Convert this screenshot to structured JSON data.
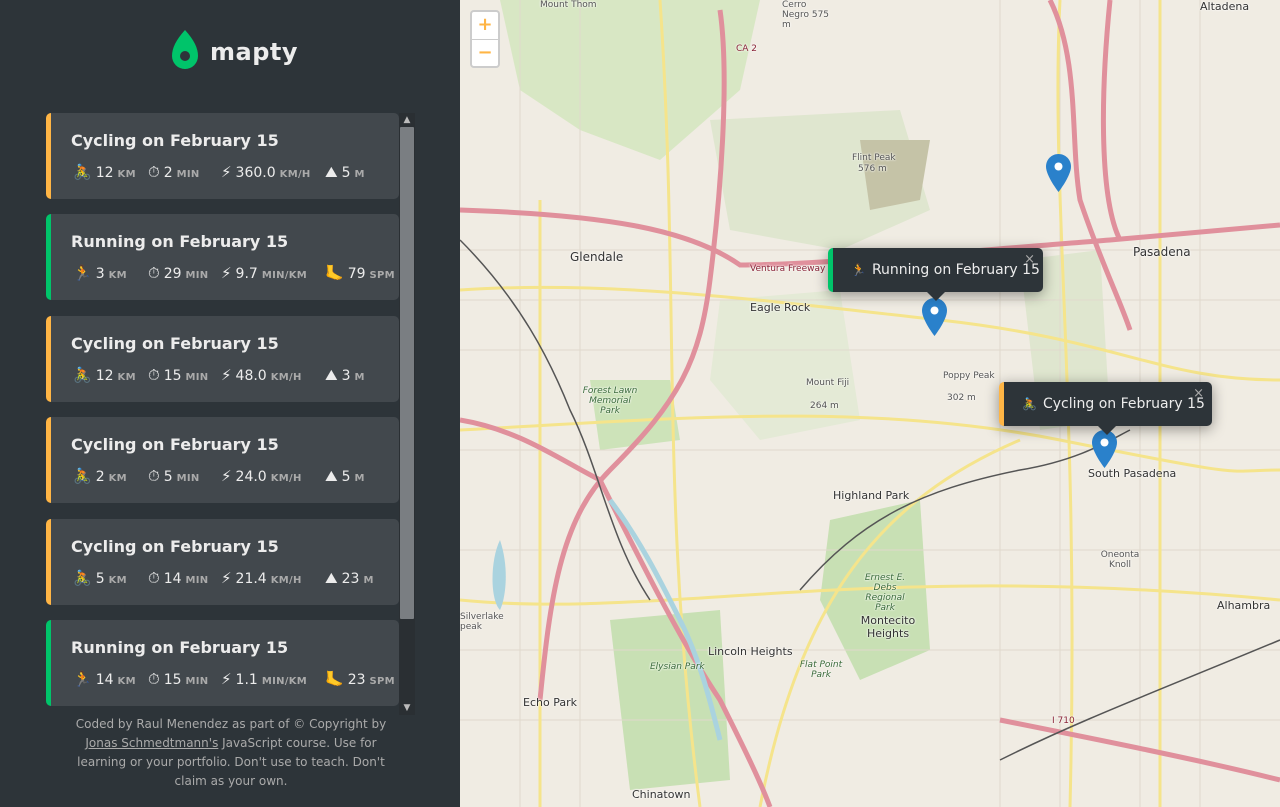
{
  "brand": {
    "name": "mapty"
  },
  "workouts": [
    {
      "type": "cycling",
      "title": "Cycling on February 15",
      "stats": [
        {
          "icon": "bicycle-icon",
          "glyph": "🚴",
          "value": "12",
          "unit": "KM"
        },
        {
          "icon": "stopwatch-icon",
          "glyph": "⏱",
          "value": "2",
          "unit": "MIN"
        },
        {
          "icon": "lightning-icon",
          "glyph": "⚡",
          "value": "360.0",
          "unit": "KM/H"
        },
        {
          "icon": "mountain-icon",
          "glyph": "⛰",
          "value": "5",
          "unit": "M"
        }
      ]
    },
    {
      "type": "running",
      "title": "Running on February 15",
      "stats": [
        {
          "icon": "runner-icon",
          "glyph": "🏃",
          "value": "3",
          "unit": "KM"
        },
        {
          "icon": "stopwatch-icon",
          "glyph": "⏱",
          "value": "29",
          "unit": "MIN"
        },
        {
          "icon": "lightning-icon",
          "glyph": "⚡",
          "value": "9.7",
          "unit": "MIN/KM"
        },
        {
          "icon": "footprint-icon",
          "glyph": "🦶",
          "value": "79",
          "unit": "SPM"
        }
      ]
    },
    {
      "type": "cycling",
      "title": "Cycling on February 15",
      "stats": [
        {
          "icon": "bicycle-icon",
          "glyph": "🚴",
          "value": "12",
          "unit": "KM"
        },
        {
          "icon": "stopwatch-icon",
          "glyph": "⏱",
          "value": "15",
          "unit": "MIN"
        },
        {
          "icon": "lightning-icon",
          "glyph": "⚡",
          "value": "48.0",
          "unit": "KM/H"
        },
        {
          "icon": "mountain-icon",
          "glyph": "⛰",
          "value": "3",
          "unit": "M"
        }
      ]
    },
    {
      "type": "cycling",
      "title": "Cycling on February 15",
      "stats": [
        {
          "icon": "bicycle-icon",
          "glyph": "🚴",
          "value": "2",
          "unit": "KM"
        },
        {
          "icon": "stopwatch-icon",
          "glyph": "⏱",
          "value": "5",
          "unit": "MIN"
        },
        {
          "icon": "lightning-icon",
          "glyph": "⚡",
          "value": "24.0",
          "unit": "KM/H"
        },
        {
          "icon": "mountain-icon",
          "glyph": "⛰",
          "value": "5",
          "unit": "M"
        }
      ]
    },
    {
      "type": "cycling",
      "title": "Cycling on February 15",
      "stats": [
        {
          "icon": "bicycle-icon",
          "glyph": "🚴",
          "value": "5",
          "unit": "KM"
        },
        {
          "icon": "stopwatch-icon",
          "glyph": "⏱",
          "value": "14",
          "unit": "MIN"
        },
        {
          "icon": "lightning-icon",
          "glyph": "⚡",
          "value": "21.4",
          "unit": "KM/H"
        },
        {
          "icon": "mountain-icon",
          "glyph": "⛰",
          "value": "23",
          "unit": "M"
        }
      ]
    },
    {
      "type": "running",
      "title": "Running on February 15",
      "stats": [
        {
          "icon": "runner-icon",
          "glyph": "🏃",
          "value": "14",
          "unit": "KM"
        },
        {
          "icon": "stopwatch-icon",
          "glyph": "⏱",
          "value": "15",
          "unit": "MIN"
        },
        {
          "icon": "lightning-icon",
          "glyph": "⚡",
          "value": "1.1",
          "unit": "MIN/KM"
        },
        {
          "icon": "footprint-icon",
          "glyph": "🦶",
          "value": "23",
          "unit": "SPM"
        }
      ]
    }
  ],
  "footer": {
    "text_before": "Coded by Raul Menendez as part of © Copyright by ",
    "link": "Jonas Schmedtmann's",
    "text_after": " JavaScript course. Use for learning or your portfolio. Don't use to teach. Don't claim as your own."
  },
  "map": {
    "zoom_in": "+",
    "zoom_out": "−",
    "popups": [
      {
        "type": "running",
        "glyph": "🏃",
        "label": "Running on February 15",
        "close": "×"
      },
      {
        "type": "cycling",
        "glyph": "🚴",
        "label": "Cycling on February 15",
        "close": "×"
      }
    ],
    "places": [
      "Glendale",
      "Pasadena",
      "Eagle Rock",
      "Highland Park",
      "South Pasadena",
      "Lincoln Heights",
      "Echo Park",
      "Chinatown",
      "Alhambra",
      "Montecito Heights",
      "Altadena",
      "Flint Peak",
      "576 m",
      "Mount Fiji",
      "264 m",
      "Poppy Peak",
      "302 m",
      "Forest Lawn Memorial Park",
      "Ernest E. Debs Regional Park",
      "Elysian Park",
      "Flat Point Park",
      "Oneonta Knoll",
      "Silverlake peak",
      "Mount Thom",
      "Cerro Negro 575 m",
      "Ventura Freeway",
      "CA 2",
      "I 710"
    ],
    "colors": {
      "running": "#00c46a",
      "cycling": "#ffb545",
      "marker": "#2a81cb"
    }
  }
}
